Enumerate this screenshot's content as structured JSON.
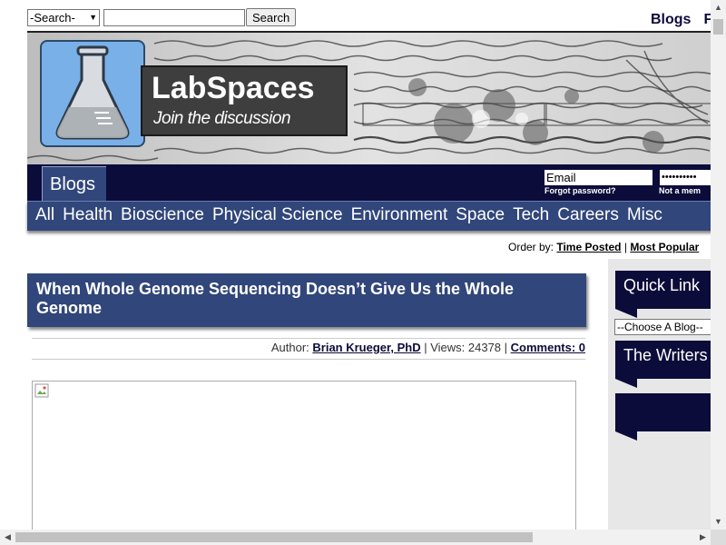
{
  "search": {
    "select_value": "-Search-",
    "input_value": "",
    "button_label": "Search"
  },
  "top_links": [
    "Blogs",
    "F"
  ],
  "banner": {
    "brand_name": "LabSpaces",
    "tagline": "Join the discussion"
  },
  "nav": {
    "active_tab": "Blogs",
    "email_placeholder": "Email",
    "password_mask": "••••••••••",
    "forgot_password": "Forgot password?",
    "not_member": "Not a mem",
    "categories": [
      "All",
      "Health",
      "Bioscience",
      "Physical Science",
      "Environment",
      "Space",
      "Tech",
      "Careers",
      "Misc"
    ]
  },
  "order_by": {
    "label": "Order by:",
    "time_posted": "Time Posted",
    "separator": "|",
    "most_popular": "Most Popular"
  },
  "article": {
    "title": "When Whole Genome Sequencing Doesn’t Give Us the Whole Genome",
    "author_label": "Author:",
    "author_name": "Brian Krueger, PhD",
    "views_text": "| Views: 24378 |",
    "comments_link": "Comments: 0"
  },
  "sidebar": {
    "quick_link": "Quick Link",
    "choose_blog": "--Choose A Blog--",
    "writers": "The Writers",
    "third_header": ""
  },
  "colors": {
    "navy": "#0c0c3a",
    "nav_blue": "#31467a",
    "sidebar_bg": "#e7e7e7"
  }
}
